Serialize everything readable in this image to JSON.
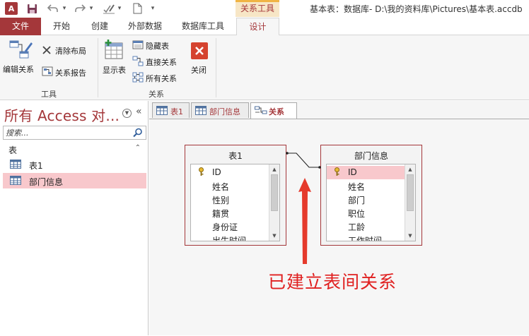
{
  "colors": {
    "accent": "#a4373a",
    "context_tab": "#f7e6c6",
    "selection": "#f8c8cc",
    "annotation": "#e02020"
  },
  "titlebar": {
    "app_logo": "A",
    "context_tab_title": "关系工具",
    "window_title": "基本表：数据库- D:\\我的资料库\\Pictures\\基本表.accdb"
  },
  "ribbon_tabs": {
    "file": "文件",
    "home": "开始",
    "create": "创建",
    "external": "外部数据",
    "dbtools": "数据库工具",
    "design": "设计"
  },
  "ribbon": {
    "edit_relations": "编辑关系",
    "clear_layout": "清除布局",
    "relation_report": "关系报告",
    "show_table": "显示表",
    "hide_table": "隐藏表",
    "direct_relations": "直接关系",
    "all_relations": "所有关系",
    "close": "关闭",
    "group_tools": "工具",
    "group_relations": "关系"
  },
  "nav": {
    "title": "所有 Access 对...",
    "search_placeholder": "搜索...",
    "group_label": "表",
    "items": [
      {
        "label": "表1"
      },
      {
        "label": "部门信息"
      }
    ]
  },
  "doc_tabs": [
    {
      "label": "表1"
    },
    {
      "label": "部门信息"
    },
    {
      "label": "关系"
    }
  ],
  "relationship_tables": [
    {
      "title": "表1",
      "fields": [
        "ID",
        "姓名",
        "性别",
        "籍贯",
        "身份证",
        "出生时间"
      ]
    },
    {
      "title": "部门信息",
      "fields": [
        "ID",
        "姓名",
        "部门",
        "职位",
        "工龄",
        "工作时间"
      ]
    }
  ],
  "annotation": "已建立表间关系"
}
